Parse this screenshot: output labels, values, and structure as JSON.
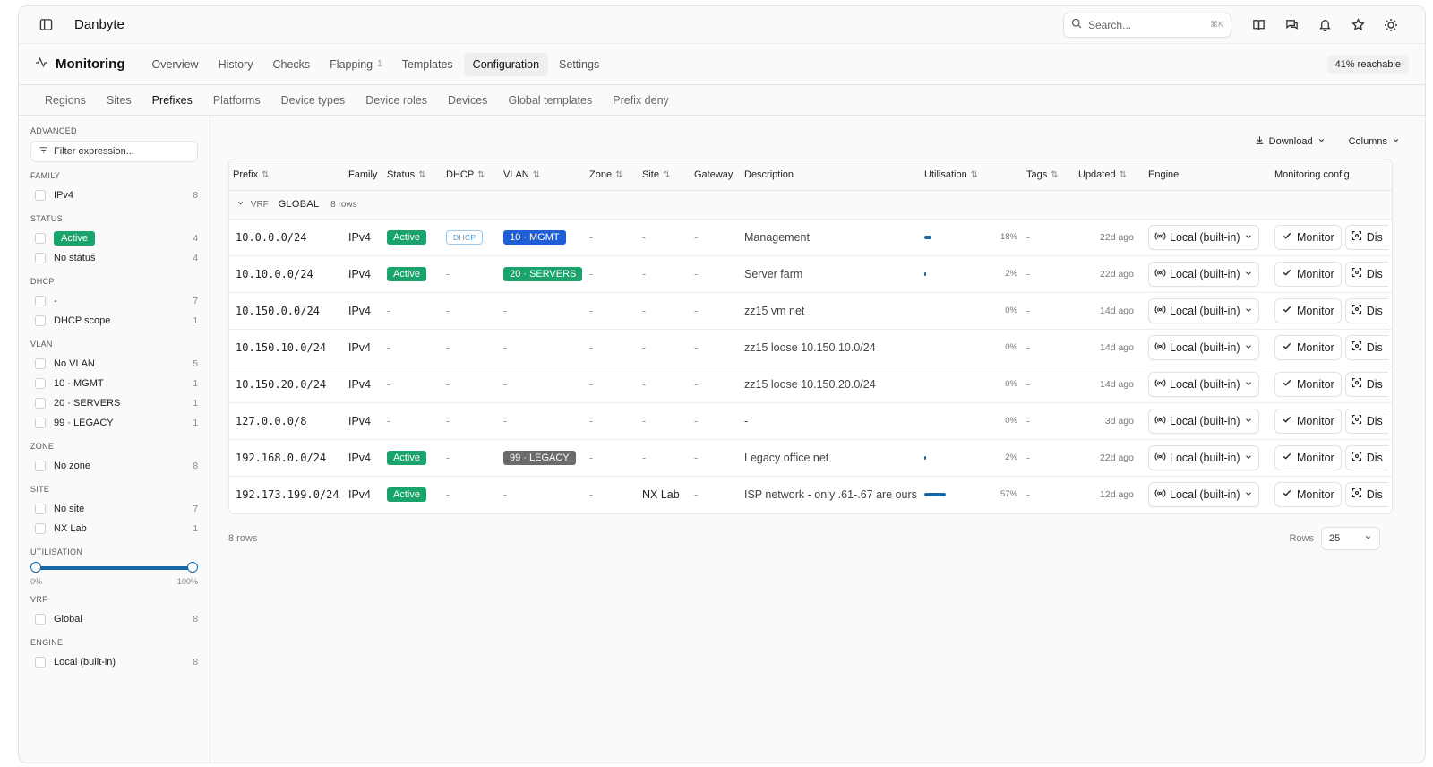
{
  "app": {
    "brand": "Danbyte"
  },
  "search": {
    "placeholder": "Search...",
    "shortcut": "⌘K"
  },
  "module": {
    "title": "Monitoring",
    "tabs": [
      {
        "label": "Overview"
      },
      {
        "label": "History"
      },
      {
        "label": "Checks"
      },
      {
        "label": "Flapping",
        "count": "1"
      },
      {
        "label": "Templates"
      },
      {
        "label": "Configuration"
      },
      {
        "label": "Settings"
      }
    ],
    "reachable": "41% reachable"
  },
  "subtabs": [
    "Regions",
    "Sites",
    "Prefixes",
    "Platforms",
    "Device types",
    "Device roles",
    "Devices",
    "Global templates",
    "Prefix deny"
  ],
  "filters": {
    "advanced_heading": "ADVANCED",
    "expression_placeholder": "Filter expression...",
    "family": {
      "heading": "FAMILY",
      "items": [
        {
          "label": "IPv4",
          "count": "8"
        }
      ]
    },
    "status": {
      "heading": "STATUS",
      "items": [
        {
          "label": "Active",
          "count": "4"
        },
        {
          "label": "No status",
          "count": "4"
        }
      ]
    },
    "dhcp": {
      "heading": "DHCP",
      "items": [
        {
          "label": "-",
          "count": "7"
        },
        {
          "label": "DHCP scope",
          "count": "1"
        }
      ]
    },
    "vlan": {
      "heading": "VLAN",
      "items": [
        {
          "label": "No VLAN",
          "count": "5"
        },
        {
          "label": "10 · MGMT",
          "count": "1"
        },
        {
          "label": "20 · SERVERS",
          "count": "1"
        },
        {
          "label": "99 · LEGACY",
          "count": "1"
        }
      ]
    },
    "zone": {
      "heading": "ZONE",
      "items": [
        {
          "label": "No zone",
          "count": "8"
        }
      ]
    },
    "site": {
      "heading": "SITE",
      "items": [
        {
          "label": "No site",
          "count": "7"
        },
        {
          "label": "NX Lab",
          "count": "1"
        }
      ]
    },
    "utilisation": {
      "heading": "UTILISATION",
      "min_label": "0%",
      "max_label": "100%",
      "min": 0,
      "max": 100
    },
    "vrf": {
      "heading": "VRF",
      "items": [
        {
          "label": "Global",
          "count": "8"
        }
      ]
    },
    "engine": {
      "heading": "ENGINE",
      "items": [
        {
          "label": "Local (built-in)",
          "count": "8"
        }
      ]
    }
  },
  "toolbar": {
    "download": "Download",
    "columns": "Columns"
  },
  "table": {
    "columns": [
      "Prefix",
      "Family",
      "Status",
      "DHCP",
      "VLAN",
      "Zone",
      "Site",
      "Gateway",
      "Description",
      "Utilisation",
      "Tags",
      "Updated",
      "Engine",
      "Monitoring config"
    ],
    "group": {
      "type": "VRF",
      "name": "GLOBAL",
      "count": "8 rows"
    },
    "rows": [
      {
        "prefix": "10.0.0.0/24",
        "family": "IPv4",
        "status": "Active",
        "dhcp": "DHCP",
        "vlan": "10 · MGMT",
        "vlan_color": "#1f5fd6",
        "zone": "-",
        "site": "-",
        "gateway": "-",
        "description": "Management",
        "util": 18,
        "util_label": "18%",
        "tags": "-",
        "updated": "22d ago",
        "engine": "Local (built-in)",
        "monitor": "Monitor",
        "dis": "Dis"
      },
      {
        "prefix": "10.10.0.0/24",
        "family": "IPv4",
        "status": "Active",
        "dhcp": "-",
        "vlan": "20 · SERVERS",
        "vlan_color": "#1aa36b",
        "zone": "-",
        "site": "-",
        "gateway": "-",
        "description": "Server farm",
        "util": 2,
        "util_label": "2%",
        "tags": "-",
        "updated": "22d ago",
        "engine": "Local (built-in)",
        "monitor": "Monitor",
        "dis": "Dis"
      },
      {
        "prefix": "10.150.0.0/24",
        "family": "IPv4",
        "status": "-",
        "dhcp": "-",
        "vlan": "-",
        "zone": "-",
        "site": "-",
        "gateway": "-",
        "description": "zz15 vm net",
        "util": 0,
        "util_label": "0%",
        "tags": "-",
        "updated": "14d ago",
        "engine": "Local (built-in)",
        "monitor": "Monitor",
        "dis": "Dis"
      },
      {
        "prefix": "10.150.10.0/24",
        "family": "IPv4",
        "status": "-",
        "dhcp": "-",
        "vlan": "-",
        "zone": "-",
        "site": "-",
        "gateway": "-",
        "description": "zz15 loose 10.150.10.0/24",
        "util": 0,
        "util_label": "0%",
        "tags": "-",
        "updated": "14d ago",
        "engine": "Local (built-in)",
        "monitor": "Monitor",
        "dis": "Dis"
      },
      {
        "prefix": "10.150.20.0/24",
        "family": "IPv4",
        "status": "-",
        "dhcp": "-",
        "vlan": "-",
        "zone": "-",
        "site": "-",
        "gateway": "-",
        "description": "zz15 loose 10.150.20.0/24",
        "util": 0,
        "util_label": "0%",
        "tags": "-",
        "updated": "14d ago",
        "engine": "Local (built-in)",
        "monitor": "Monitor",
        "dis": "Dis"
      },
      {
        "prefix": "127.0.0.0/8",
        "family": "IPv4",
        "status": "-",
        "dhcp": "-",
        "vlan": "-",
        "zone": "-",
        "site": "-",
        "gateway": "-",
        "description": "-",
        "util": 0,
        "util_label": "0%",
        "tags": "-",
        "updated": "3d ago",
        "engine": "Local (built-in)",
        "monitor": "Monitor",
        "dis": "Dis"
      },
      {
        "prefix": "192.168.0.0/24",
        "family": "IPv4",
        "status": "Active",
        "dhcp": "-",
        "vlan": "99 · LEGACY",
        "vlan_color": "#6b6b6b",
        "zone": "-",
        "site": "-",
        "gateway": "-",
        "description": "Legacy office net",
        "util": 2,
        "util_label": "2%",
        "tags": "-",
        "updated": "22d ago",
        "engine": "Local (built-in)",
        "monitor": "Monitor",
        "dis": "Dis"
      },
      {
        "prefix": "192.173.199.0/24",
        "family": "IPv4",
        "status": "Active",
        "dhcp": "-",
        "vlan": "-",
        "zone": "-",
        "site": "NX Lab",
        "gateway": "-",
        "description": "ISP network - only .61-.67 are ours",
        "util": 57,
        "util_label": "57%",
        "tags": "-",
        "updated": "12d ago",
        "engine": "Local (built-in)",
        "monitor": "Monitor",
        "dis": "Dis"
      }
    ]
  },
  "footer": {
    "row_count": "8 rows",
    "rows_label": "Rows",
    "rows_value": "25"
  },
  "colors": {
    "active": "#1aa36b",
    "accent": "#1566a8"
  }
}
